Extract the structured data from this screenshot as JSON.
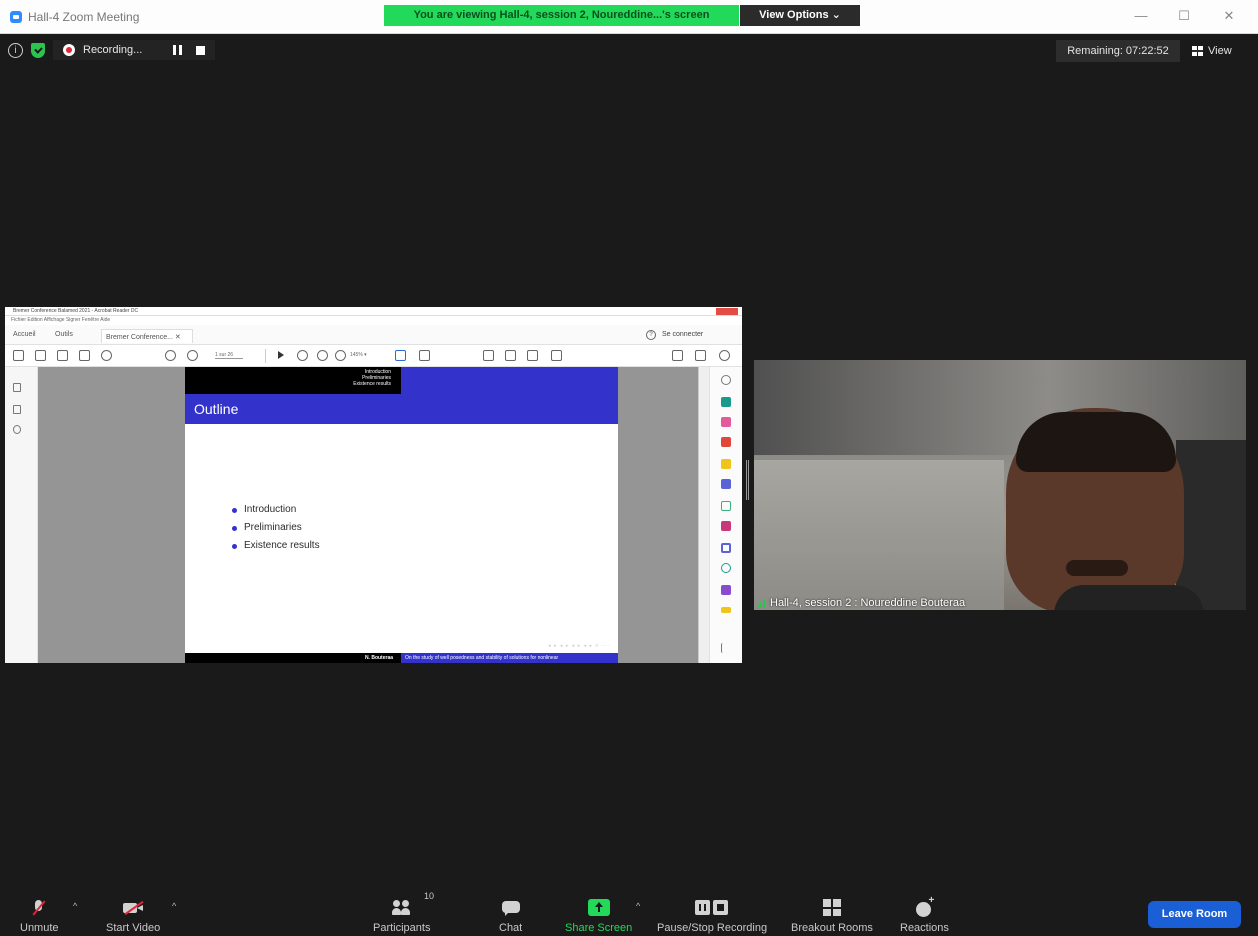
{
  "window": {
    "title": "Hall-4 Zoom Meeting",
    "viewing_banner": "You are viewing Hall-4, session 2, Noureddine...'s screen",
    "view_options": "View Options ⌄",
    "controls": {
      "minimize": "—",
      "maximize": "☐",
      "close": "✕"
    }
  },
  "status": {
    "info": "i",
    "recording_label": "Recording...",
    "remaining": "Remaining: 07:22:52",
    "view_label": "View"
  },
  "shared_screen": {
    "title": "Bremer Conference Balamed 2021 - Acrobat Reader DC",
    "menu": "Fichier  Edition  Affichage  Signer  Fenêtre  Aide",
    "tabs": {
      "home": "Accueil",
      "tools": "Outils",
      "document": "Bremer Conference... ✕"
    },
    "connect": "Se connecter",
    "page_field": "1  sur 26",
    "zoom": "145%  ▾",
    "slide": {
      "nav_links": [
        "Introduction",
        "Preliminaries",
        "Existence results"
      ],
      "frame_title": "Outline",
      "bullets": [
        "Introduction",
        "Preliminaries",
        "Existence results"
      ],
      "controls": "◂ ▸  ◂ ▸  ◂ ▸  ◂ ▸  ≡  ◦◦◦",
      "footer_author": "N. Bouteraa",
      "footer_title": "On the study of well posedness and stability of solutions for nonlinear"
    }
  },
  "video": {
    "label": "Hall-4, session 2 : Noureddine Bouteraa"
  },
  "toolbar": {
    "unmute": "Unmute",
    "start_video": "Start Video",
    "participants": "Participants",
    "participant_count": "10",
    "chat": "Chat",
    "share_screen": "Share Screen",
    "pause_stop": "Pause/Stop Recording",
    "breakout": "Breakout Rooms",
    "reactions": "Reactions",
    "leave": "Leave Room",
    "caret": "^"
  },
  "colors": {
    "banner": "#23d959",
    "recording": "#e0263a",
    "slide_blue": "#3333cc",
    "leave": "#1a5fd6"
  }
}
